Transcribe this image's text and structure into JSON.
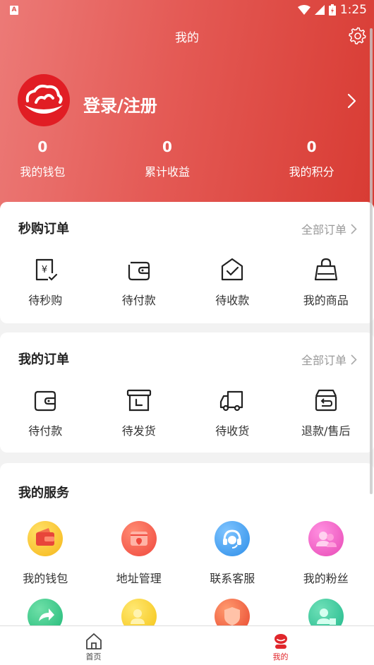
{
  "status_bar": {
    "time": "1:25",
    "app_icon_letter": "A"
  },
  "header": {
    "title": "我的",
    "login_label": "登录/注册"
  },
  "stats": [
    {
      "value": "0",
      "label": "我的钱包"
    },
    {
      "value": "0",
      "label": "累计收益"
    },
    {
      "value": "0",
      "label": "我的积分"
    }
  ],
  "flash_orders": {
    "title": "秒购订单",
    "all_label": "全部订单",
    "items": [
      {
        "label": "待秒购",
        "icon": "yuan-bill-icon"
      },
      {
        "label": "待付款",
        "icon": "wallet-icon"
      },
      {
        "label": "待收款",
        "icon": "envelope-check-icon"
      },
      {
        "label": "我的商品",
        "icon": "shopping-bag-icon"
      }
    ]
  },
  "my_orders": {
    "title": "我的订单",
    "all_label": "全部订单",
    "items": [
      {
        "label": "待付款",
        "icon": "wallet-icon"
      },
      {
        "label": "待发货",
        "icon": "box-clock-icon"
      },
      {
        "label": "待收货",
        "icon": "truck-icon"
      },
      {
        "label": "退款/售后",
        "icon": "refund-box-icon"
      }
    ]
  },
  "services": {
    "title": "我的服务",
    "items": [
      {
        "label": "我的钱包",
        "icon": "wallet-service-icon",
        "color": "#f6b71a"
      },
      {
        "label": "地址管理",
        "icon": "address-icon",
        "color": "#f0493e"
      },
      {
        "label": "联系客服",
        "icon": "customer-service-icon",
        "color": "#2d8ee8"
      },
      {
        "label": "我的粉丝",
        "icon": "fans-icon",
        "color": "#e84ab6"
      }
    ]
  },
  "tabbar": {
    "items": [
      {
        "label": "首页",
        "icon": "home-icon"
      },
      {
        "label": "我的",
        "icon": "profile-icon"
      }
    ],
    "active_color": "#e0262b"
  },
  "colors": {
    "header_start": "#ec7a77",
    "header_end": "#d83b33",
    "accent": "#e0262b"
  }
}
